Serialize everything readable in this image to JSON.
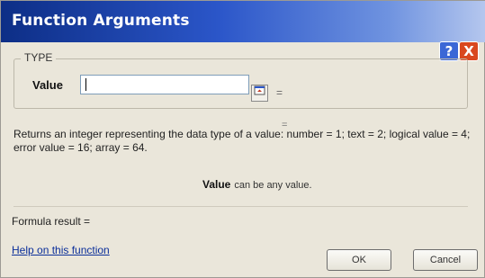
{
  "window": {
    "title": "Function Arguments",
    "help_button": "?",
    "close_button": "X"
  },
  "arguments": {
    "function_name": "TYPE",
    "value_label": "Value",
    "value_input": "",
    "collapse_icon": "collapse-dialog-icon",
    "equals": "=",
    "result_equals": "="
  },
  "description": {
    "text": "Returns an integer representing the data type of a value: number = 1; text = 2; logical value = 4; error value = 16; array = 64.",
    "arg_name": "Value",
    "arg_text": "can be any value."
  },
  "footer": {
    "formula_result": "Formula result =",
    "help_link": "Help on this function",
    "ok_label": "OK",
    "cancel_label": "Cancel"
  },
  "colors": {
    "title_bar_start": "#0d2e86",
    "title_bar_end": "#b5c7ee",
    "dialog_bg": "#eae6da",
    "link": "#0b2f9a"
  }
}
